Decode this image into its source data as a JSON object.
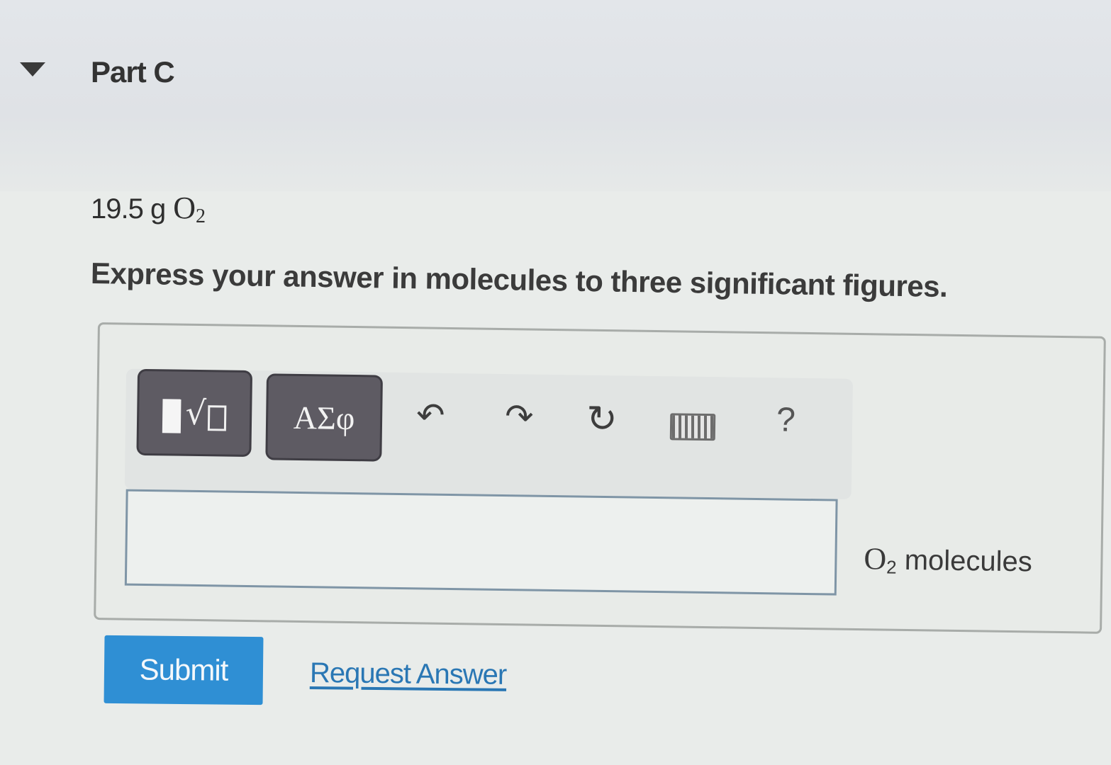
{
  "part": {
    "title": "Part C"
  },
  "question": {
    "given_quantity": "19.5 g",
    "given_species": "O",
    "given_subscript": "2",
    "instruction": "Express your answer in molecules to three significant figures."
  },
  "toolbar": {
    "template_icon": "templates-radical-icon",
    "symbols_label": "ΑΣφ",
    "undo_icon": "undo-icon",
    "redo_icon": "redo-icon",
    "reset_icon": "reset-icon",
    "keyboard_icon": "keyboard-icon",
    "help_label": "?"
  },
  "answer": {
    "value": "",
    "units_species": "O",
    "units_subscript": "2",
    "units_text": "molecules"
  },
  "actions": {
    "submit_label": "Submit",
    "request_answer_label": "Request Answer"
  },
  "colors": {
    "submit_bg": "#2f8fd4",
    "link": "#2a77b4",
    "tool_button_bg": "#5e5b63"
  }
}
